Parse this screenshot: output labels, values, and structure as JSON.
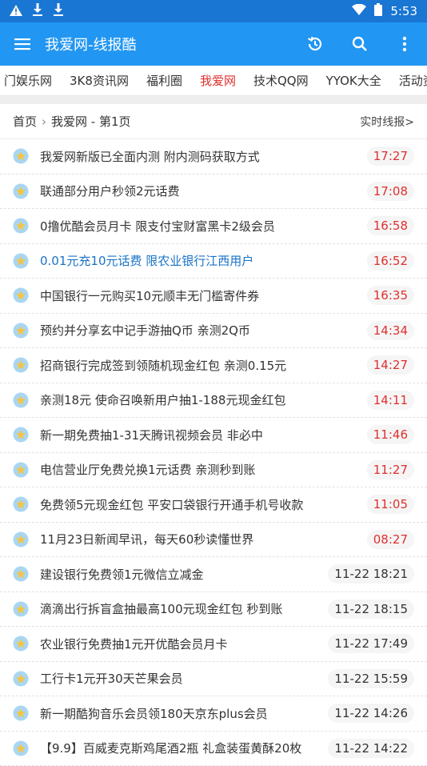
{
  "status": {
    "time": "5:53"
  },
  "appbar": {
    "title": "我爱网-线报酷"
  },
  "tabs": [
    "门娱乐网",
    "3K8资讯网",
    "福利圈",
    "我爱网",
    "技术QQ网",
    "YYOK大全",
    "活动资"
  ],
  "active_tab_index": 3,
  "breadcrumb": {
    "home": "首页",
    "section": "我爱网 - 第1页",
    "live_link": "实时线报>"
  },
  "colors": {
    "appbar": "#2196f3",
    "statusbar": "#1976d2",
    "active_tab": "#e0302e",
    "highlight_link": "#1a73c7",
    "today_time": "#e0302e"
  },
  "items": [
    {
      "title": "我爱网新版已全面内测 附内测码获取方式",
      "time": "17:27",
      "today": true
    },
    {
      "title": "联通部分用户秒领2元话费",
      "time": "17:08",
      "today": true
    },
    {
      "title": "0撸优酷会员月卡 限支付宝财富黑卡2级会员",
      "time": "16:58",
      "today": true
    },
    {
      "title": "0.01元充10元话费 限农业银行江西用户",
      "time": "16:52",
      "today": true,
      "highlight": true
    },
    {
      "title": "中国银行一元购买10元顺丰无门槛寄件券",
      "time": "16:35",
      "today": true
    },
    {
      "title": "预约并分享玄中记手游抽Q币 亲测2Q币",
      "time": "14:34",
      "today": true
    },
    {
      "title": "招商银行完成签到领随机现金红包 亲测0.15元",
      "time": "14:27",
      "today": true
    },
    {
      "title": "亲测18元 使命召唤新用户抽1-188元现金红包",
      "time": "14:11",
      "today": true
    },
    {
      "title": "新一期免费抽1-31天腾讯视频会员 非必中",
      "time": "11:46",
      "today": true
    },
    {
      "title": "电信营业厅免费兑换1元话费 亲测秒到账",
      "time": "11:27",
      "today": true
    },
    {
      "title": "免费领5元现金红包 平安口袋银行开通手机号收款",
      "time": "11:05",
      "today": true
    },
    {
      "title": "11月23日新闻早讯，每天60秒读懂世界",
      "time": "08:27",
      "today": true
    },
    {
      "title": "建设银行免费领1元微信立减金",
      "time": "11-22 18:21",
      "today": false
    },
    {
      "title": "滴滴出行拆盲盒抽最高100元现金红包 秒到账",
      "time": "11-22 18:15",
      "today": false
    },
    {
      "title": "农业银行免费抽1元开优酷会员月卡",
      "time": "11-22 17:49",
      "today": false
    },
    {
      "title": "工行卡1元开30天芒果会员",
      "time": "11-22 15:59",
      "today": false
    },
    {
      "title": "新一期酷狗音乐会员领180天京东plus会员",
      "time": "11-22 14:26",
      "today": false
    },
    {
      "title": "【9.9】百威麦克斯鸡尾酒2瓶 礼盒装蛋黄酥20枚",
      "time": "11-22 14:22",
      "today": false
    }
  ]
}
